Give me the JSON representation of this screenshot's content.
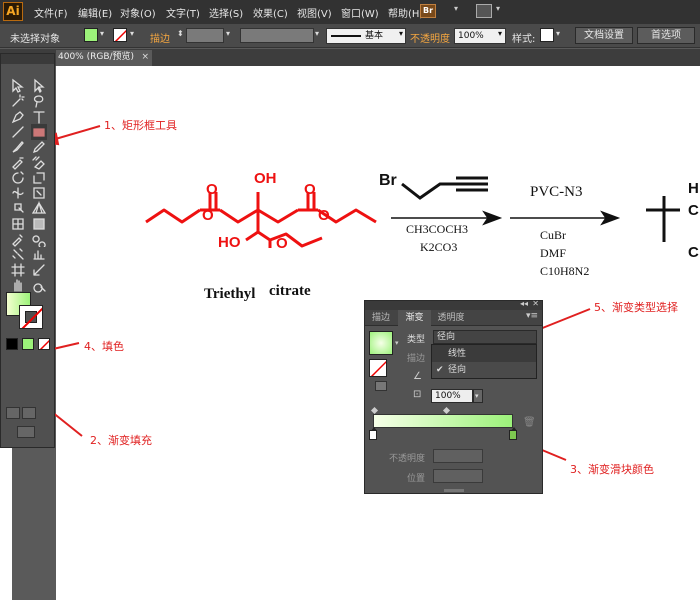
{
  "app": {
    "logo": "Ai"
  },
  "menu": {
    "items": [
      "文件(F)",
      "编辑(E)",
      "对象(O)",
      "文字(T)",
      "选择(S)",
      "效果(C)",
      "视图(V)",
      "窗口(W)",
      "帮助(H)"
    ],
    "bridge_label": "Br"
  },
  "control_bar": {
    "selection_status": "未选择对象",
    "stroke_label": "描边",
    "brush_label": "基本",
    "opacity_label": "不透明度",
    "opacity_value": "100%",
    "style_label": "样式:",
    "doc_setup_button": "文档设置",
    "prefs_button": "首选项"
  },
  "document_tab": {
    "title": "400% (RGB/预览)",
    "close": "×"
  },
  "gradient_panel": {
    "tabs": [
      "描边",
      "渐变",
      "透明度"
    ],
    "active_tab": "渐变",
    "type_label": "类型",
    "type_value": "径向",
    "type_options": [
      {
        "label": "线性",
        "checked": false
      },
      {
        "label": "径向",
        "checked": true
      }
    ],
    "stroke_label": "描边",
    "ratio_value": "100%",
    "opacity_label": "不透明度",
    "position_label": "位置",
    "gradient_colors": {
      "start": "#f6ffe8",
      "end": "#9cf27a"
    }
  },
  "annotations": {
    "rect_tool": "1、矩形框工具",
    "gradient_fill": "2、渐变填充",
    "slider_color": "3、渐变滑块颜色",
    "fill": "4、填色",
    "gradient_type": "5、渐变类型选择",
    "color": "#e02020"
  },
  "chemistry": {
    "compound_name": "Triethyl",
    "compound_name_2": "citrate",
    "oh_top": "OH",
    "ho_bottom": "HO",
    "reagent_br": "Br",
    "step1_conditions_1": "CH3COCH3",
    "step1_conditions_2": "K2CO3",
    "step2_reagent": "PVC-N3",
    "step2_conditions": [
      "CuBr",
      "DMF",
      "C10H8N2"
    ],
    "partial_product_letters": [
      "H",
      "C",
      "C"
    ],
    "highlight_color": "#ee1111"
  }
}
